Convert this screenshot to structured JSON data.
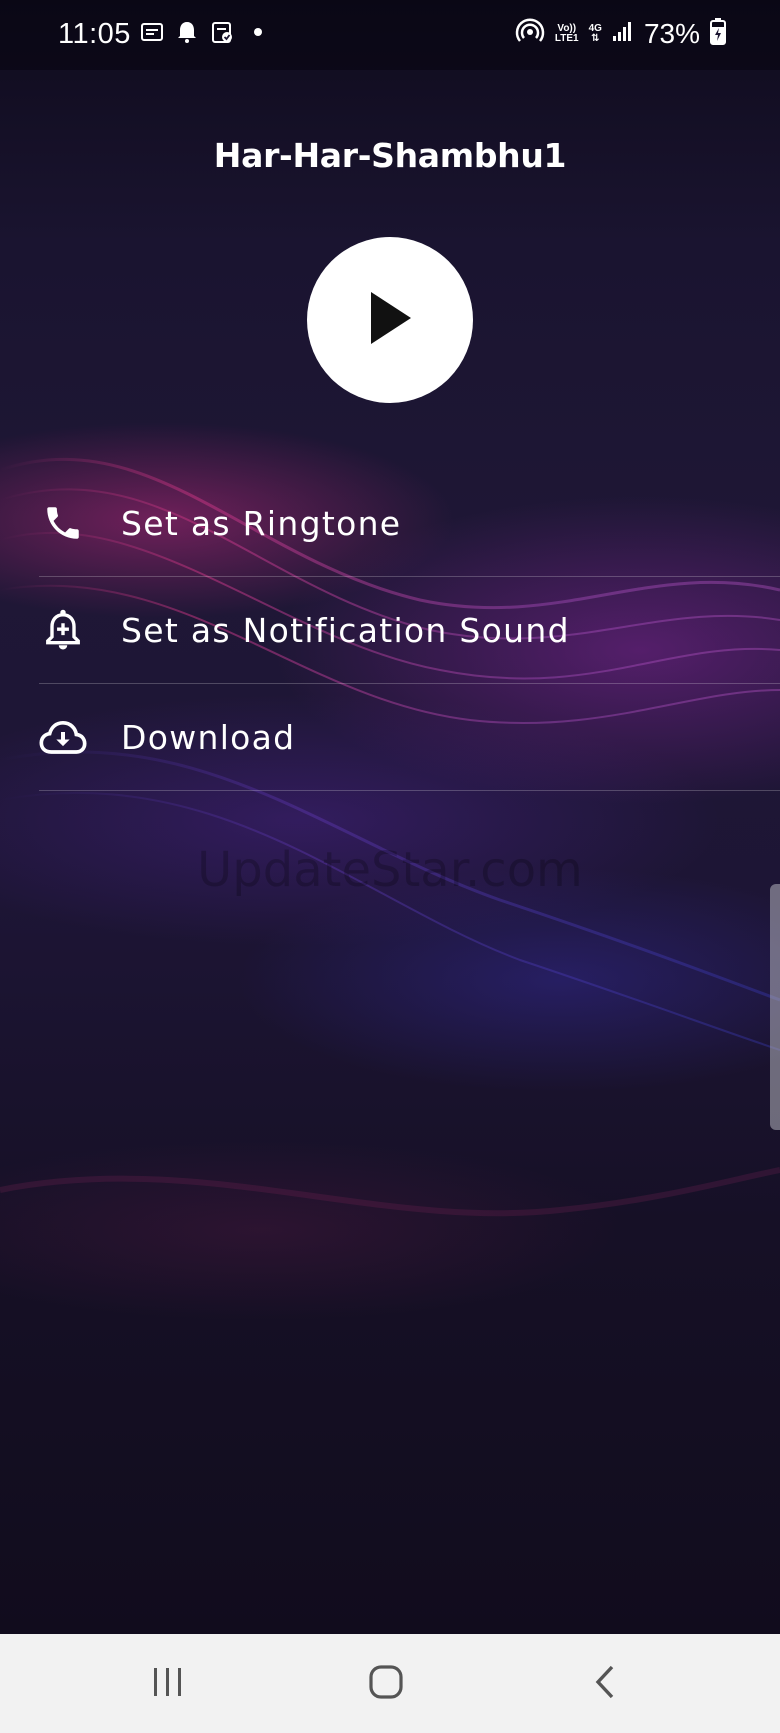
{
  "status_bar": {
    "time": "11:05",
    "left_icons": [
      "sim-notification-icon",
      "bell-icon",
      "clipboard-check-icon",
      "dot-icon"
    ],
    "network_label_top": "Vo))",
    "network_label_bottom": "LTE1",
    "data_type": "4G",
    "battery": "73%"
  },
  "player": {
    "title": "Har-Har-Shambhu1",
    "play_icon": "play-icon"
  },
  "menu": {
    "items": [
      {
        "label": "Set as Ringtone",
        "icon": "phone-icon"
      },
      {
        "label": "Set as Notification Sound",
        "icon": "notification-add-icon"
      },
      {
        "label": "Download",
        "icon": "cloud-download-icon"
      }
    ]
  },
  "watermark": "UpdateStar.com",
  "nav_bar": {
    "buttons": [
      "recents-icon",
      "home-icon",
      "back-icon"
    ]
  }
}
